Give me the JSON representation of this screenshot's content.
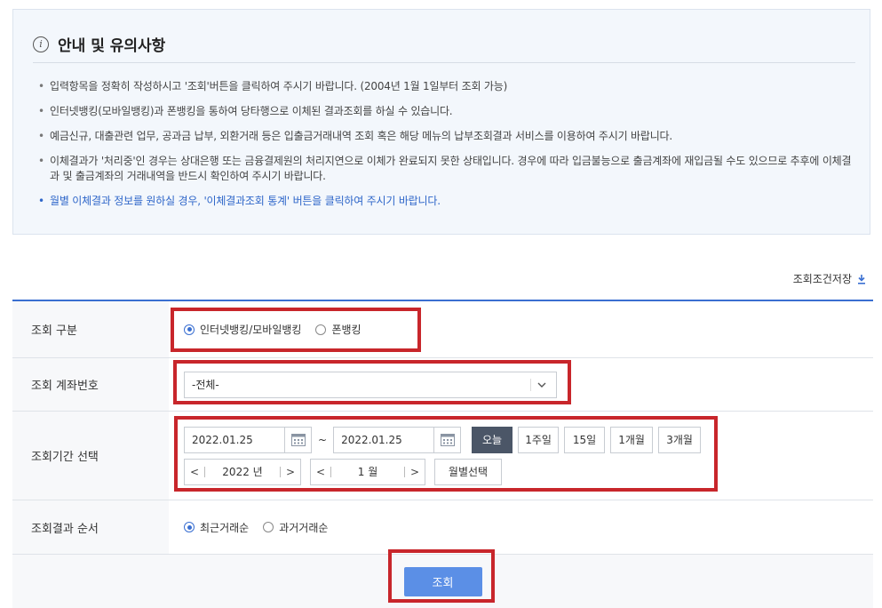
{
  "notice": {
    "title": "안내 및 유의사항",
    "items": [
      {
        "text": "입력항목을 정확히 작성하시고 '조회'버튼을 클릭하여 주시기 바랍니다. (2004년 1월 1일부터 조회 가능)"
      },
      {
        "text": "인터넷뱅킹(모바일뱅킹)과 폰뱅킹을 통하여 당타행으로 이체된 결과조회를 하실 수 있습니다."
      },
      {
        "text": "예금신규, 대출관련 업무, 공과금 납부, 외환거래 등은 입출금거래내역 조회 혹은 해당 메뉴의 납부조회결과 서비스를 이용하여 주시기 바랍니다."
      },
      {
        "text": "이체결과가 '처리중'인 경우는 상대은행 또는 금융결제원의 처리지연으로 이체가 완료되지 못한 상태입니다. 경우에 따라 입금불능으로 출금계좌에 재입금될 수도 있으므로 추후에 이체결과 및 출금계좌의 거래내역을 반드시 확인하여 주시기 바랍니다."
      },
      {
        "text": "월별 이체결과 정보를 원하실 경우, '이체결과조회 통계' 버튼을 클릭하여 주시기 바랍니다.",
        "color": "#2e66c9"
      }
    ]
  },
  "save_condition_label": "조회조건저장",
  "form": {
    "query_type": {
      "label": "조회 구분",
      "options": [
        "인터넷뱅킹/모바일뱅킹",
        "폰뱅킹"
      ],
      "selected": 0
    },
    "account": {
      "label": "조회 계좌번호",
      "value": "-전체-"
    },
    "period": {
      "label": "조회기간 선택",
      "start_date": "2022.01.25",
      "end_date": "2022.01.25",
      "tilde": "~",
      "quick_buttons": [
        "오늘",
        "1주일",
        "15일",
        "1개월",
        "3개월"
      ],
      "active_quick": 0,
      "year": "2022 년",
      "month": "1 월",
      "month_select_label": "월별선택"
    },
    "order": {
      "label": "조회결과 순서",
      "options": [
        "최근거래순",
        "과거거래순"
      ],
      "selected": 0
    },
    "submit_label": "조회"
  },
  "colors": {
    "accent": "#3a6fd1",
    "highlight": "#c8262b",
    "submit": "#5b8fe6",
    "active_button": "#4b5667"
  },
  "icons": [
    "info-icon",
    "download-icon",
    "calendar-icon",
    "chevron-down-icon",
    "chevron-left-icon",
    "chevron-right-icon"
  ]
}
